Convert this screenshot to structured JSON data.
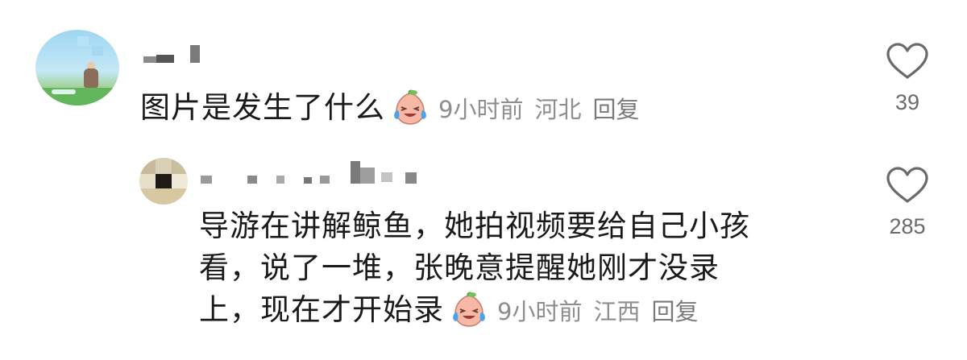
{
  "comments": [
    {
      "text": "图片是发生了什么",
      "emoji": "laughing-tears-peach-emoji",
      "time": "9小时前",
      "location": "河北",
      "reply_label": "回复",
      "likes": "39"
    }
  ],
  "reply": {
    "lines": [
      "导游在讲解鲸鱼，她拍视频要给自己小孩",
      "看，说了一堆，张晚意提醒她刚才没录",
      "上，现在才开始录"
    ],
    "emoji": "laughing-tears-peach-emoji",
    "time": "9小时前",
    "location": "江西",
    "reply_label": "回复",
    "likes": "285"
  },
  "colors": {
    "body_text": "#1a1a1a",
    "meta_text": "#8e8e8e",
    "like_icon": "#6a6a6a",
    "emoji_face": "#f7b9a6",
    "emoji_tears": "#4aa3e8"
  }
}
